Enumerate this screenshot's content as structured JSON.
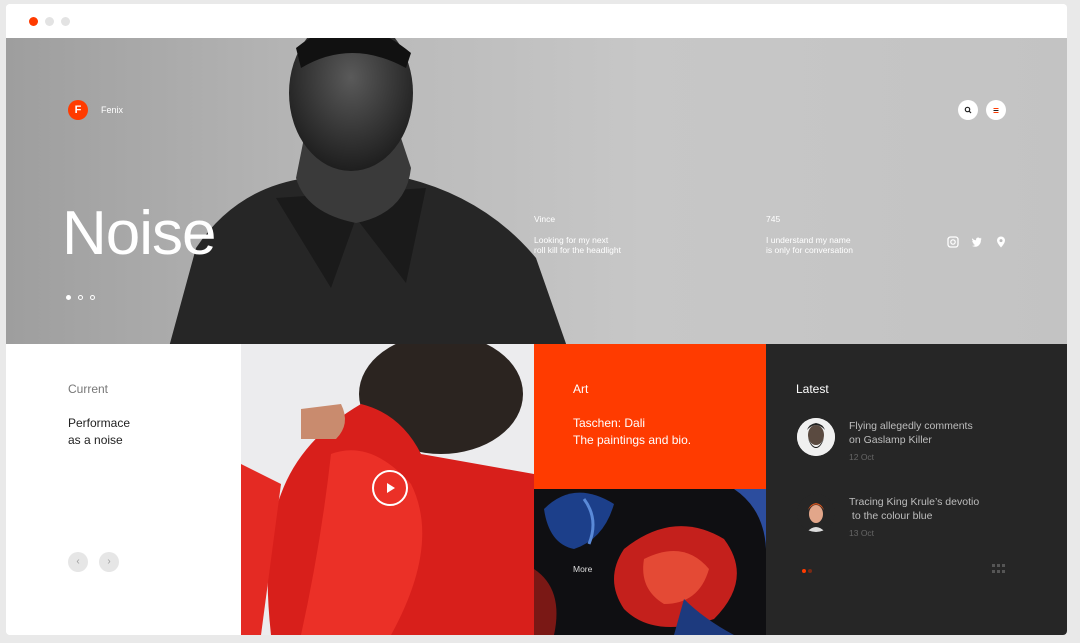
{
  "window": {
    "dots": [
      "#ff3b00",
      "#e3e3e3",
      "#e3e3e3"
    ]
  },
  "hero": {
    "logo_letter": "F",
    "brand": "Fenix",
    "title": "Noise",
    "col1": {
      "title": "Vince",
      "line1": "Looking for my next",
      "line2": "roll kill for the headlight"
    },
    "col2": {
      "title": "745",
      "line1": "I understand my name",
      "line2": "is only for conversation"
    },
    "pager_active": 1,
    "pager_total": 3
  },
  "current": {
    "label": "Current",
    "line1": "Performace",
    "line2": "as a noise",
    "prev": "‹",
    "next": "›"
  },
  "art": {
    "label": "Art",
    "line1": "Taschen: Dali",
    "line2": "The paintings and bio.",
    "more": "More"
  },
  "latest": {
    "label": "Latest",
    "items": [
      {
        "line1": "Flying allegedly comments",
        "line2": "on Gaslamp Killer",
        "date": "12 Oct"
      },
      {
        "line1": "Tracing King Krule’s devotio",
        "line2": " to the colour blue",
        "date": "13 Oct"
      }
    ]
  },
  "colors": {
    "accent": "#ff3b00",
    "dark": "#262626"
  }
}
